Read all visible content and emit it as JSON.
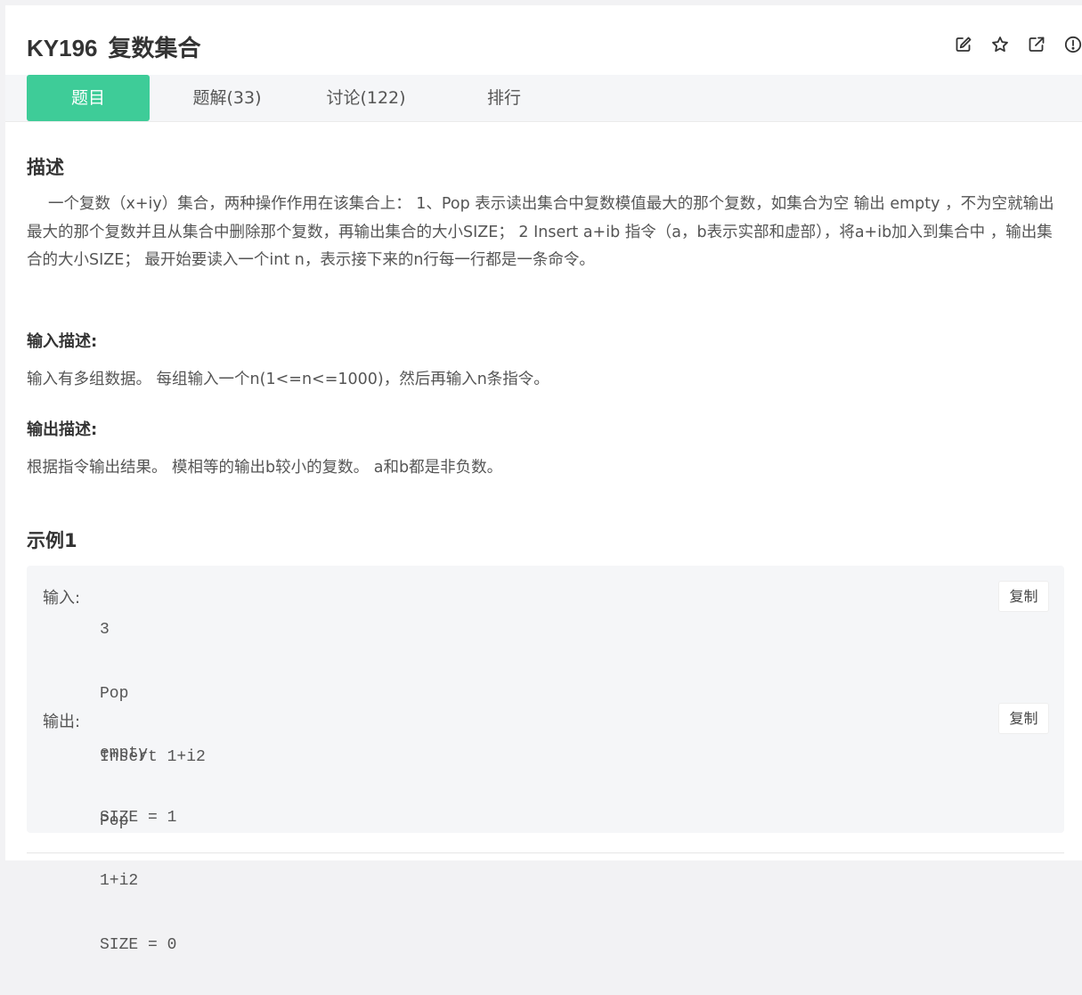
{
  "problem": {
    "id": "KY196",
    "name": "复数集合"
  },
  "actions": [
    {
      "icon": "edit-icon"
    },
    {
      "icon": "star-icon"
    },
    {
      "icon": "external-link-icon"
    },
    {
      "icon": "report-icon"
    }
  ],
  "tabs": [
    {
      "label": "题目",
      "active": true
    },
    {
      "label": "题解(33)",
      "active": false
    },
    {
      "label": "讨论(122)",
      "active": false
    },
    {
      "label": "排行",
      "active": false
    }
  ],
  "description": {
    "heading": "描述",
    "text": "一个复数（x+iy）集合，两种操作作用在该集合上：      1、Pop 表示读出集合中复数模值最大的那个复数，如集合为空 输出  empty  ，不为空就输出最大的那个复数并且从集合中删除那个复数，再输出集合的大小SIZE；      2 Insert a+ib  指令（a，b表示实部和虚部），将a+ib加入到集合中 ，输出集合的大小SIZE；      最开始要读入一个int n，表示接下来的n行每一行都是一条命令。"
  },
  "input_desc": {
    "heading": "输入描述:",
    "text": "输入有多组数据。 每组输入一个n(1<=n<=1000)，然后再输入n条指令。"
  },
  "output_desc": {
    "heading": "输出描述:",
    "text": "根据指令输出结果。 模相等的输出b较小的复数。 a和b都是非负数。"
  },
  "example": {
    "heading": "示例1",
    "input_label": "输入:",
    "input_lines": [
      "3",
      "Pop",
      "Insert 1+i2",
      "Pop"
    ],
    "output_label": "输出:",
    "output_lines": [
      "empty",
      "SIZE = 1",
      "1+i2",
      "SIZE = 0"
    ],
    "copy_label": "复制"
  },
  "colors": {
    "accent": "#3ecc98"
  }
}
